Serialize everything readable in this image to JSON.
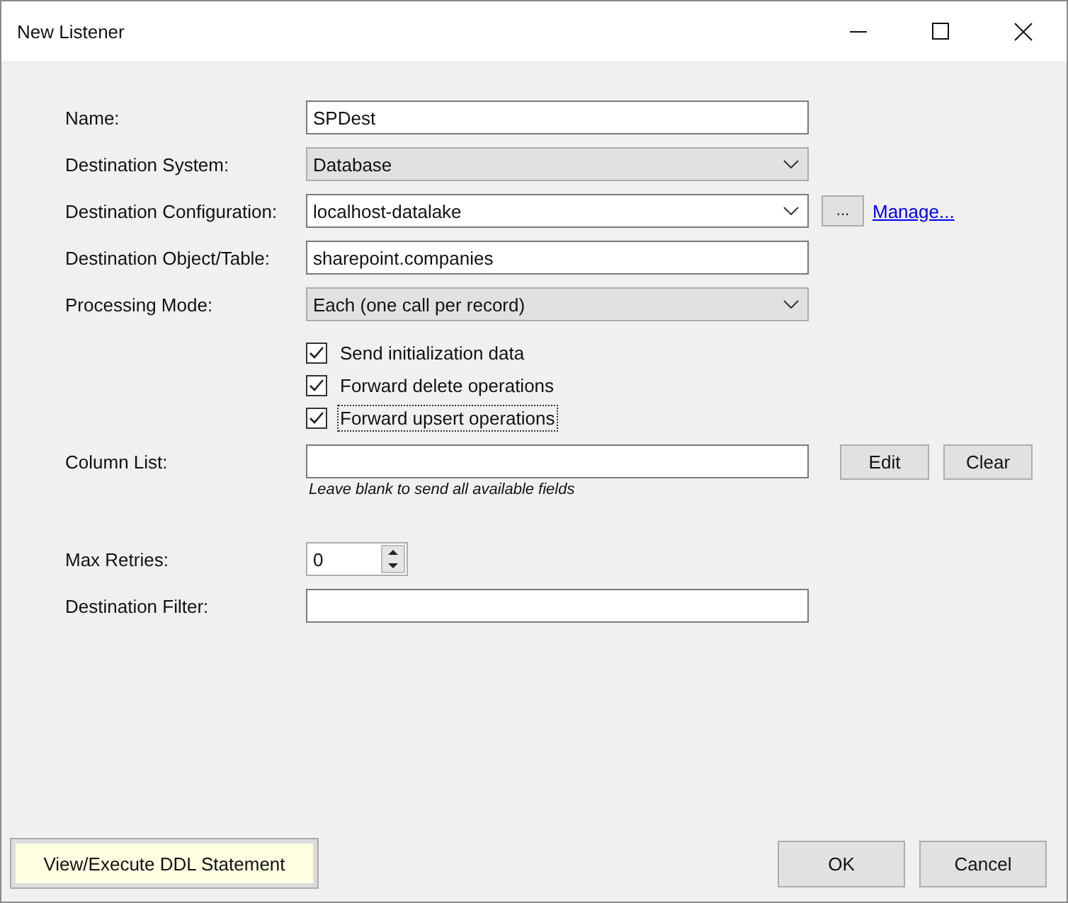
{
  "window": {
    "title": "New Listener"
  },
  "fields": [
    {
      "label": "Name:",
      "kind": "text",
      "value": "SPDest"
    },
    {
      "label": "Destination System:",
      "kind": "dropdown",
      "value": "Database"
    },
    {
      "label": "Destination Configuration:",
      "kind": "combo",
      "value": "localhost-datalake",
      "browse_button": "...",
      "link": "Manage..."
    },
    {
      "label": "Destination Object/Table:",
      "kind": "text",
      "value": "sharepoint.companies"
    },
    {
      "label": "Processing Mode:",
      "kind": "dropdown",
      "value": "Each (one call per record)"
    }
  ],
  "checkboxes": [
    {
      "label": "Send initialization data",
      "checked": true,
      "focused": false
    },
    {
      "label": "Forward delete operations",
      "checked": true,
      "focused": false
    },
    {
      "label": "Forward upsert operations",
      "checked": true,
      "focused": true
    }
  ],
  "column_list": {
    "label": "Column List:",
    "buttons": [
      "Edit",
      "Clear"
    ],
    "hint": "Leave blank to send all available fields"
  },
  "max_retries": {
    "label": "Max Retries:",
    "value": "0"
  },
  "destination_filter": {
    "label": "Destination Filter:"
  },
  "footer": {
    "ddl_button": "View/Execute DDL Statement",
    "buttons": [
      "OK",
      "Cancel"
    ]
  }
}
